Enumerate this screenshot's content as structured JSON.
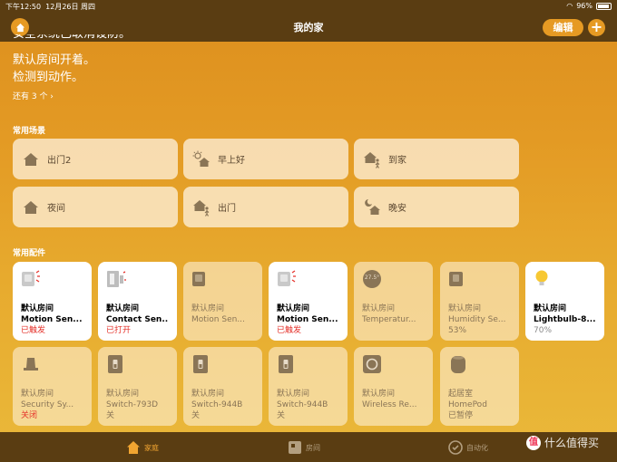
{
  "status": {
    "time": "下午12:50",
    "date": "12月26日 周四",
    "battery": "96%"
  },
  "nav": {
    "title": "我的家",
    "edit": "编辑",
    "add": "+"
  },
  "summary": {
    "line0": "安全系统已取消设防。",
    "line1": "默认房间开着。",
    "line2": "检测到动作。",
    "more": "还有 3 个 ›"
  },
  "scenes_title": "常用场景",
  "scenes": [
    {
      "label": "出门2",
      "icon": "house-icon"
    },
    {
      "label": "早上好",
      "icon": "sun-house-icon"
    },
    {
      "label": "到家",
      "icon": "person-house-icon"
    },
    {
      "label": "夜间",
      "icon": "house-icon"
    },
    {
      "label": "出门",
      "icon": "person-house-icon"
    },
    {
      "label": "晚安",
      "icon": "moon-house-icon"
    }
  ],
  "accessories_title": "常用配件",
  "accessories": [
    {
      "room": "默认房间",
      "name": "Motion Sen...",
      "state": "已触发",
      "state_color": "red",
      "on": true,
      "icon": "motion-sensor-icon"
    },
    {
      "room": "默认房间",
      "name": "Contact Sen...",
      "state": "已打开",
      "state_color": "red",
      "on": true,
      "icon": "contact-sensor-icon"
    },
    {
      "room": "默认房间",
      "name": "Motion Sen...",
      "state": "",
      "state_color": "gray",
      "on": false,
      "icon": "motion-sensor-icon"
    },
    {
      "room": "默认房间",
      "name": "Motion Sen...",
      "state": "已触发",
      "state_color": "red",
      "on": true,
      "icon": "motion-sensor-icon"
    },
    {
      "room": "默认房间",
      "name": "Temperatur...",
      "state": "",
      "state_color": "gray",
      "on": false,
      "icon": "thermometer-icon",
      "reading": "27.5°"
    },
    {
      "room": "默认房间",
      "name": "Humidity Se...",
      "state": "53%",
      "state_color": "gray",
      "on": false,
      "icon": "humidity-sensor-icon"
    },
    {
      "room": "默认房间",
      "name": "Lightbulb-8...",
      "state": "70%",
      "state_color": "gray",
      "on": true,
      "icon": "lightbulb-icon"
    },
    {
      "room": "默认房间",
      "name": "Security Sy...",
      "state": "关闭",
      "state_color": "red",
      "on": false,
      "icon": "security-system-icon"
    },
    {
      "room": "默认房间",
      "name": "Switch-793D",
      "state": "关",
      "state_color": "gray",
      "on": false,
      "icon": "switch-icon"
    },
    {
      "room": "默认房间",
      "name": "Switch-944B",
      "state": "关",
      "state_color": "gray",
      "on": false,
      "icon": "switch-icon"
    },
    {
      "room": "默认房间",
      "name": "Switch-944B",
      "state": "关",
      "state_color": "gray",
      "on": false,
      "icon": "switch-icon"
    },
    {
      "room": "默认房间",
      "name": "Wireless Re...",
      "state": "",
      "state_color": "gray",
      "on": false,
      "icon": "wireless-remote-icon"
    },
    {
      "room": "起居室",
      "name": "HomePod",
      "state": "已暂停",
      "state_color": "gray",
      "on": false,
      "icon": "homepod-icon"
    }
  ],
  "tabs": [
    {
      "label": "家庭",
      "icon": "home-tab-icon",
      "active": true
    },
    {
      "label": "房间",
      "icon": "rooms-tab-icon",
      "active": false
    },
    {
      "label": "自动化",
      "icon": "automation-tab-icon",
      "active": false
    }
  ],
  "watermark": {
    "badge": "值",
    "text": "什么值得买"
  },
  "colors": {
    "accent": "#f2a531",
    "bar": "#5a3d12",
    "triggered": "#e5322b"
  }
}
